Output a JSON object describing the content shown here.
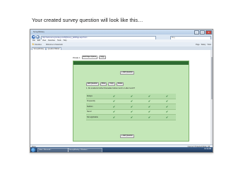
{
  "slide": {
    "caption": "Your created survey question  will look like this…"
  },
  "browser": {
    "window_title": "SurveyMonkey",
    "address": "http://www.surveymonkey.com/MySurvey_EditPage.aspx?sm=...",
    "search_placeholder": "Bing",
    "menu": [
      "File",
      "Edit",
      "View",
      "Favorites",
      "Tools",
      "Help"
    ],
    "favorites_label": "Favorites",
    "favorites_item": "Welcome to Facebook",
    "command_items": [
      "Page",
      "Safety",
      "Tools"
    ],
    "tabs": [
      "SurveyMonkey",
      "Question Builder"
    ],
    "status_left": "Done",
    "status_right": "Internet | Protected Mode: Off"
  },
  "survey_page": {
    "page_label": "PAGE 1",
    "page_select": "Edit Page Options",
    "page_button": "Copy",
    "add_question_top": "+ Add Question",
    "question_actions": [
      "Edit Question",
      "Move",
      "Copy",
      "Delete"
    ],
    "question_text": "1. Do students bother Ramadan before lunch or after lunch?",
    "rows": [
      "Always",
      "Frequently",
      "Seldom",
      "Never",
      "Not applicable"
    ],
    "check_glyph": "✔",
    "columns_count": 4,
    "add_question_bottom": "+ Add Question"
  },
  "taskbar": {
    "buttons": [
      "Inbox - Microsoft...",
      "SurveyMonkey - Windows..."
    ],
    "clock": "10:12 AM"
  },
  "colors": {
    "panel_green": "#c4e7b8",
    "header_green": "#2f6b32",
    "check_green": "#1f6b2a"
  }
}
